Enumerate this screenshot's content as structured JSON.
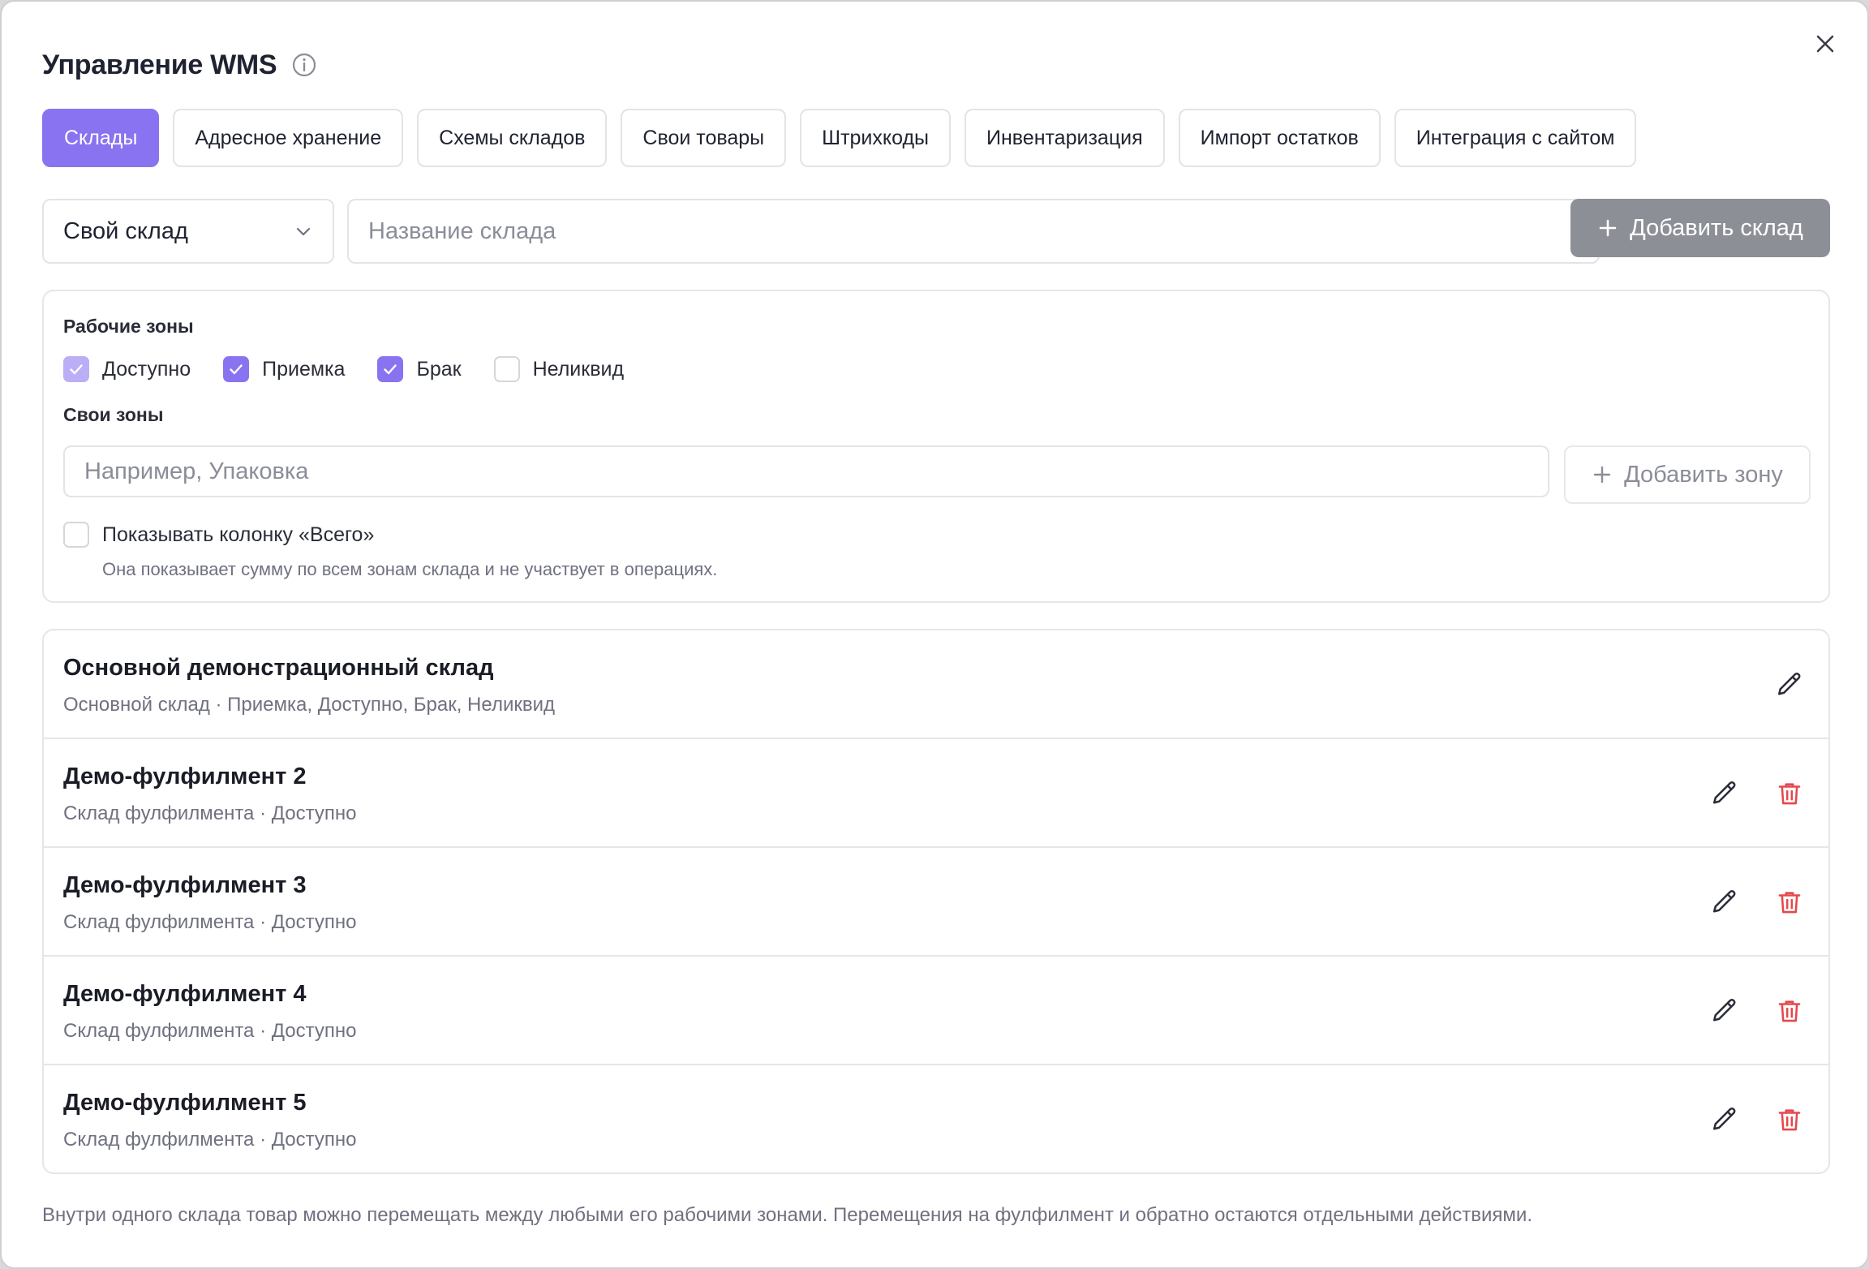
{
  "modal": {
    "title": "Управление WMS"
  },
  "tabs": [
    {
      "label": "Склады",
      "active": true
    },
    {
      "label": "Адресное хранение",
      "active": false
    },
    {
      "label": "Схемы складов",
      "active": false
    },
    {
      "label": "Свои товары",
      "active": false
    },
    {
      "label": "Штрихкоды",
      "active": false
    },
    {
      "label": "Инвентаризация",
      "active": false
    },
    {
      "label": "Импорт остатков",
      "active": false
    },
    {
      "label": "Интеграция с сайтом",
      "active": false
    }
  ],
  "toolbar": {
    "warehouse_type": "Свой склад",
    "name_placeholder": "Название склада",
    "add_label": "Добавить склад"
  },
  "zones": {
    "work_label": "Рабочие зоны",
    "options": [
      {
        "label": "Доступно",
        "checked": true,
        "disabled": true
      },
      {
        "label": "Приемка",
        "checked": true,
        "disabled": false
      },
      {
        "label": "Брак",
        "checked": true,
        "disabled": false
      },
      {
        "label": "Неликвид",
        "checked": false,
        "disabled": false
      }
    ],
    "own_label": "Свои зоны",
    "own_placeholder": "Например, Упаковка",
    "add_zone_label": "Добавить зону",
    "total_label": "Показывать колонку «Всего»",
    "total_hint": "Она показывает сумму по всем зонам склада и не участвует в операциях.",
    "total_checked": false
  },
  "warehouses": [
    {
      "name": "Основной демонстрационный склад",
      "meta": "Основной склад · Приемка, Доступно, Брак, Неликвид",
      "deletable": false
    },
    {
      "name": "Демо-фулфилмент 2",
      "meta": "Склад фулфилмента · Доступно",
      "deletable": true
    },
    {
      "name": "Демо-фулфилмент 3",
      "meta": "Склад фулфилмента · Доступно",
      "deletable": true
    },
    {
      "name": "Демо-фулфилмент 4",
      "meta": "Склад фулфилмента · Доступно",
      "deletable": true
    },
    {
      "name": "Демо-фулфилмент 5",
      "meta": "Склад фулфилмента · Доступно",
      "deletable": true
    }
  ],
  "footer": {
    "note": "Внутри одного склада товар можно перемещать между любыми его рабочими зонами. Перемещения на фулфилмент и обратно остаются отдельными действиями."
  },
  "colors": {
    "accent": "#8a73f0",
    "danger": "#e5484d",
    "muted_button": "#8d8f97"
  }
}
